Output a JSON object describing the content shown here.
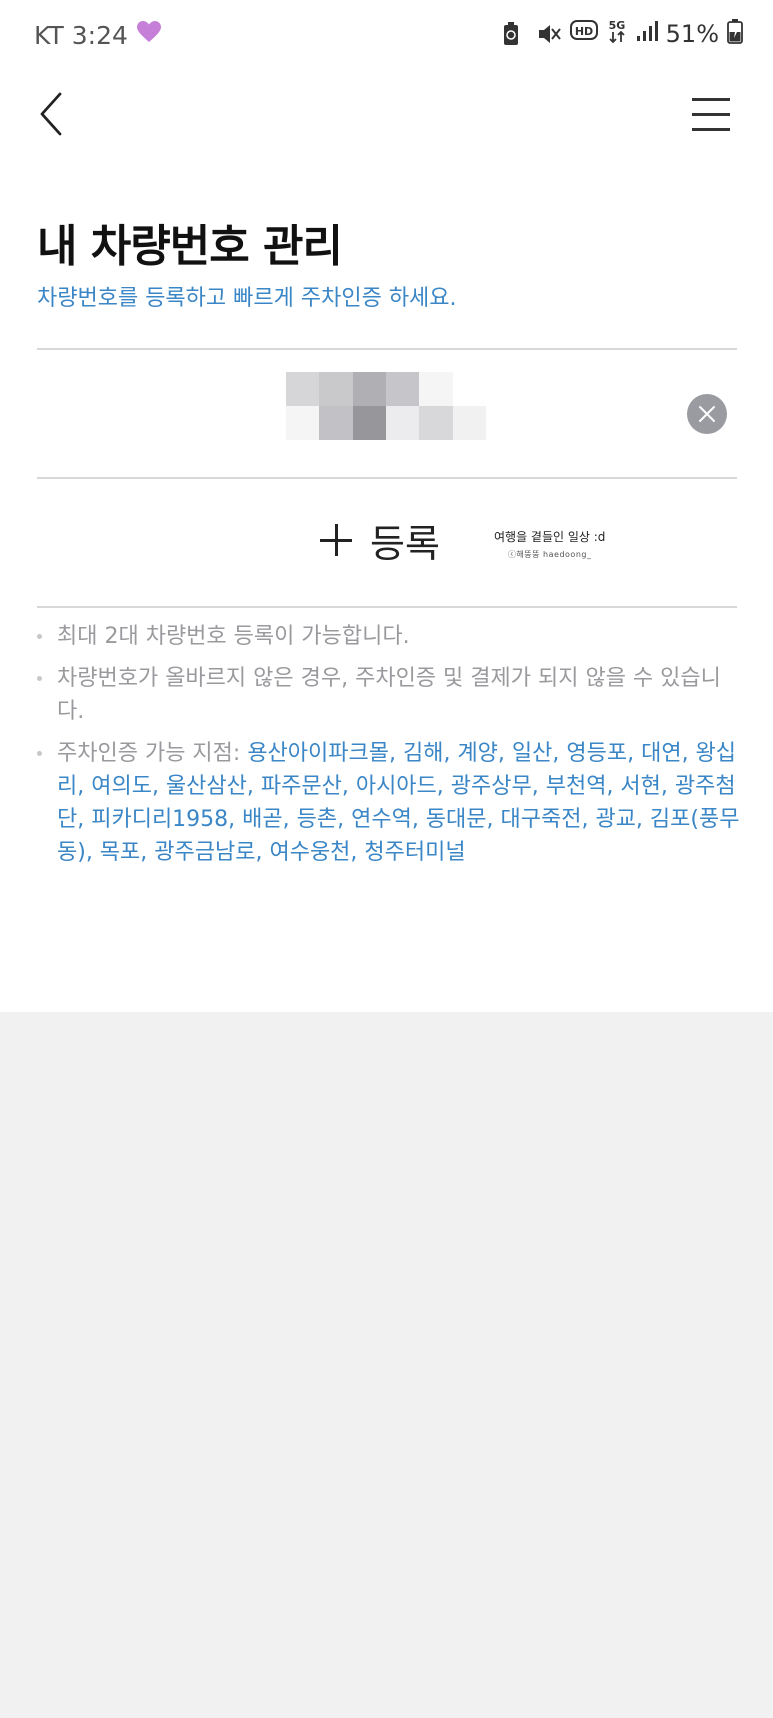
{
  "status_bar": {
    "carrier": "KT",
    "time": "3:24",
    "battery": "51%",
    "icons": [
      "heart-icon",
      "battery-saver-icon",
      "mute-icon",
      "hd-icon",
      "5g-icon",
      "signal-icon",
      "battery-charging-icon"
    ]
  },
  "header": {
    "title": "내 차량번호 관리",
    "subtitle": "차량번호를 등록하고 빠르게 주차인증 하세요."
  },
  "plate": {
    "delete_icon": "close-icon"
  },
  "register": {
    "label": "등록"
  },
  "watermark": {
    "line1": "여행을 곁들인 일상 :d",
    "line2": "ⓒ해뚱뚱 haedoong_"
  },
  "notes": {
    "item1": "최대 2대 차량번호 등록이 가능합니다.",
    "item2": "차량번호가 올바르지 않은 경우, 주차인증 및 결제가 되지 않을 수 있습니다.",
    "item3_prefix": "주차인증 가능 지점: ",
    "item3_branches": "용산아이파크몰, 김해, 계양, 일산, 영등포, 대연, 왕십리, 여의도, 울산삼산, 파주문산, 아시아드, 광주상무, 부천역, 서현, 광주첨단, 피카디리1958, 배곧, 등촌, 연수역, 동대문, 대구죽전, 광교, 김포(풍무동), 목포, 광주금남로, 여수웅천, 청주터미널"
  },
  "colors": {
    "accent": "#3a86c6",
    "note_text": "#9a9a9e",
    "delete_button": "#9a9ba1",
    "background_bottom": "#f1f1f1"
  }
}
